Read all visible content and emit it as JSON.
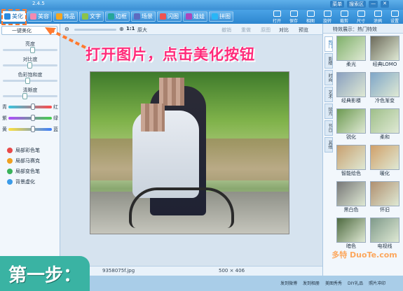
{
  "app": {
    "version": "2.4.5",
    "title_menu": [
      "菜单",
      "搜索区",
      "",
      ""
    ]
  },
  "tabs": [
    {
      "label": "美化",
      "active": true,
      "color": "#2a8be0"
    },
    {
      "label": "美容",
      "color": "#f38ab0"
    },
    {
      "label": "饰品",
      "color": "#f5a623"
    },
    {
      "label": "文字",
      "color": "#8bc34a"
    },
    {
      "label": "边框",
      "color": "#26a69a"
    },
    {
      "label": "场景",
      "color": "#5c6bc0"
    },
    {
      "label": "闪图",
      "color": "#ef5350"
    },
    {
      "label": "娃娃",
      "color": "#ab47bc"
    },
    {
      "label": "拼图",
      "color": "#29b6f6"
    }
  ],
  "toolbar": [
    "打开",
    "保存",
    "相图",
    "旋转",
    "裁剪",
    "尺寸",
    "涂鸦",
    "设置"
  ],
  "left_panel": {
    "one_key": "一键美化",
    "sliders": [
      {
        "label": "亮度",
        "value": 0.55
      },
      {
        "label": "对比度",
        "value": 0.5
      },
      {
        "label": "色彩饱和度",
        "value": 0.45
      },
      {
        "label": "清晰度",
        "value": 0.4
      }
    ],
    "color_sliders": [
      {
        "left": "青",
        "right": "红",
        "gradient": "#37c6e0,#ff4b4b"
      },
      {
        "left": "紫",
        "right": "绿",
        "gradient": "#b04bff,#44d04b"
      },
      {
        "left": "黄",
        "right": "蓝",
        "gradient": "#ffe13b,#3b7dff"
      }
    ],
    "brushes": [
      {
        "label": "局部彩色笔",
        "color": "#e84a4a"
      },
      {
        "label": "局部马赛克",
        "color": "#f0a020"
      },
      {
        "label": "局部变色笔",
        "color": "#3ab35a"
      },
      {
        "label": "背景虚化",
        "color": "#3b9be8"
      }
    ]
  },
  "canvas_bar": {
    "zoom": "1:1",
    "original": "原大",
    "undo": "撤销",
    "redo": "重做",
    "reset": "原图",
    "compare": "对比",
    "preview": "预览"
  },
  "banner": "打开图片，点击美化按钮",
  "status": {
    "filename": "9358075f.jpg",
    "dimensions": "500 × 406"
  },
  "right_panel": {
    "header": "特效展示：热门特效",
    "categories": [
      "热门",
      "影楼",
      "时尚",
      "艺术",
      "炫光",
      "节日",
      "其他"
    ],
    "effects": [
      {
        "label": "柔光",
        "tint": "#7fb06a"
      },
      {
        "label": "经典LOMO",
        "tint": "#6c6a5a"
      },
      {
        "label": "经典影楼",
        "tint": "#8aa0c0"
      },
      {
        "label": "冷色渐变",
        "tint": "#7fa6c8"
      },
      {
        "label": "锐化",
        "tint": "#6d9a52"
      },
      {
        "label": "柔和",
        "tint": "#9fbf8a"
      },
      {
        "label": "智能绘色",
        "tint": "#c8a070"
      },
      {
        "label": "暖化",
        "tint": "#d0a06a"
      },
      {
        "label": "黑白色",
        "tint": "#777777"
      },
      {
        "label": "怀旧",
        "tint": "#b09070"
      },
      {
        "label": "暗色",
        "tint": "#4e6a40"
      },
      {
        "label": "电视线",
        "tint": "#7f9a8a"
      }
    ]
  },
  "step_label": "第一步：",
  "bottom": {
    "items": [
      "发到微博",
      "发到相册",
      "美图秀秀",
      "DIY礼品",
      "照片冲印"
    ]
  },
  "watermark": "多特 DuoTe.com"
}
